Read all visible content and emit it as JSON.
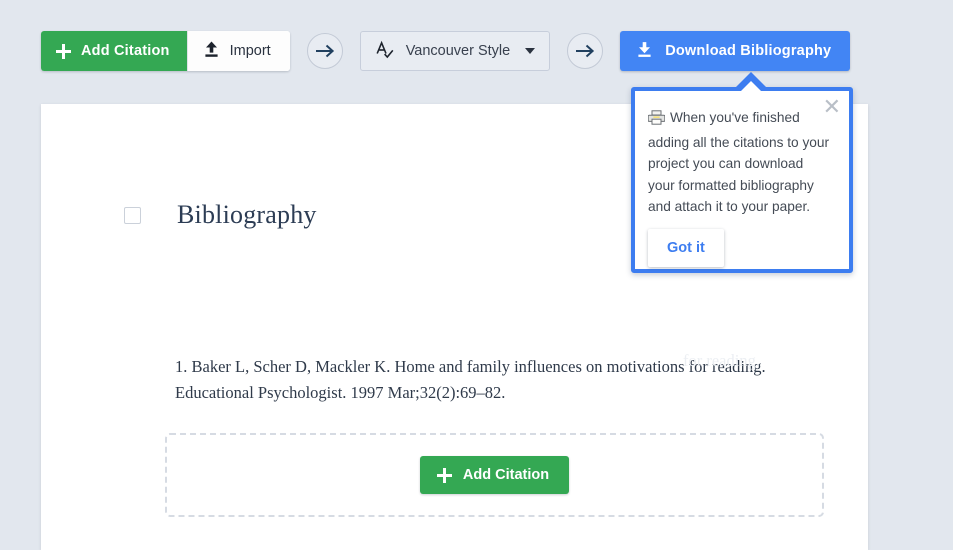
{
  "toolbar": {
    "add_citation_label": "Add Citation",
    "import_label": "Import",
    "style_label": "Vancouver Style",
    "download_label": "Download Bibliography",
    "next_arrow_1": "→",
    "next_arrow_2": "→",
    "colors": {
      "green": "#34a853",
      "blue": "#4285f4",
      "page_background": "#e2e7ee"
    }
  },
  "document": {
    "heading": "Bibliography",
    "citations": [
      "1. Baker L, Scher D, Mackler K. Home and family influences on motivations for reading. Educational Psychologist. 1997 Mar;32(2):69–82."
    ],
    "obscured_tail_text": "for reading.",
    "dropzone_add_citation_label": "Add Citation"
  },
  "tooltip": {
    "message": "When you've finished adding all the citations to your project you can download your formatted bibliography and attach it to your paper.",
    "confirm_label": "Got it",
    "close_label": "✕",
    "printer_glyph": "🖨",
    "border_color": "#3d7df0"
  }
}
